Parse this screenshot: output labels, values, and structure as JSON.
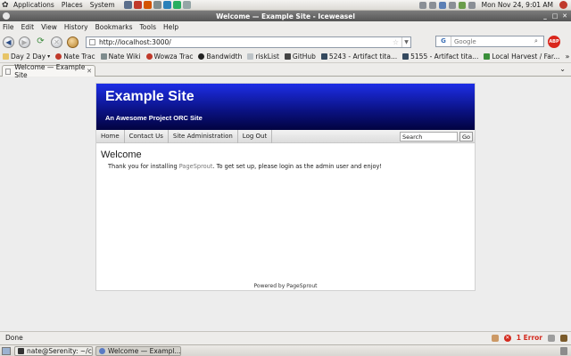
{
  "panel": {
    "menus": [
      "Applications",
      "Places",
      "System"
    ],
    "clock": "Mon Nov 24,  9:01 AM"
  },
  "window": {
    "title": "Welcome — Example Site - Iceweasel"
  },
  "menubar": [
    "File",
    "Edit",
    "View",
    "History",
    "Bookmarks",
    "Tools",
    "Help"
  ],
  "nav": {
    "url": "http://localhost:3000/",
    "search_placeholder": "Google",
    "search_engine": "G",
    "adblock_label": "ABP"
  },
  "bookmarks": [
    {
      "label": "Day 2 Day",
      "icon": "folder-icon"
    },
    {
      "label": "Nate Trac",
      "icon": "trac-icon"
    },
    {
      "label": "Nate Wiki",
      "icon": "wiki-icon"
    },
    {
      "label": "Wowza Trac",
      "icon": "trac-icon"
    },
    {
      "label": "Bandwidth",
      "icon": "bandwidth-icon"
    },
    {
      "label": "riskList",
      "icon": "page-icon"
    },
    {
      "label": "GitHub",
      "icon": "github-icon"
    },
    {
      "label": "5243 - Artifact tita...",
      "icon": "artifact-icon"
    },
    {
      "label": "5155 - Artifact tita...",
      "icon": "artifact-icon"
    },
    {
      "label": "Local Harvest / Far...",
      "icon": "harvest-icon"
    }
  ],
  "tab": {
    "label": "Welcome — Example Site"
  },
  "site": {
    "name": "Example Site",
    "tagline": "An Awesome Project ORC Site",
    "nav": [
      "Home",
      "Contact Us",
      "Site Administration",
      "Log Out"
    ],
    "search_value": "Search",
    "go_label": "Go",
    "heading": "Welcome",
    "intro_before": "Thank you for installing ",
    "intro_link": "PageSprout",
    "intro_after": ". To get set up, please login as the admin user and enjoy!",
    "footer": "Powered by PageSprout"
  },
  "status": {
    "text": "Done",
    "error_text": "1 Error"
  },
  "taskbar": [
    {
      "label": "nate@Serenity: ~/c...",
      "icon": "terminal-icon",
      "active": false
    },
    {
      "label": "Welcome — Exampl...",
      "icon": "iceweasel-icon",
      "active": true
    }
  ],
  "colors": {
    "banner_top": "#1d2ee6",
    "banner_bottom": "#020340",
    "error": "#d32a1e"
  }
}
